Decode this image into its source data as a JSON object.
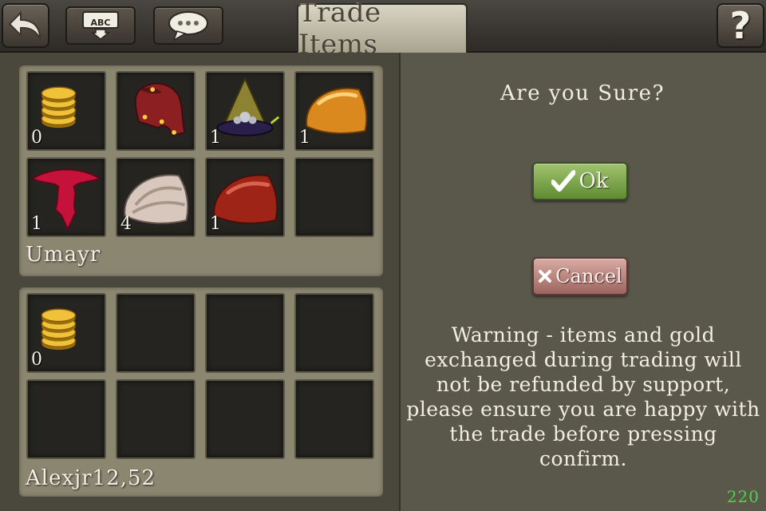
{
  "header": {
    "title": "Trade Items",
    "keyboard_label": "ABC",
    "help_label": "?"
  },
  "players": [
    {
      "name": "Umayr",
      "slots": [
        {
          "icon": "gold-coins-icon",
          "qty": "0"
        },
        {
          "icon": "red-jester-hat-icon",
          "qty": ""
        },
        {
          "icon": "skull-wizard-hat-icon",
          "qty": "1"
        },
        {
          "icon": "orange-cap-icon",
          "qty": "1"
        },
        {
          "icon": "red-wings-icon",
          "qty": "1"
        },
        {
          "icon": "marble-cap-icon",
          "qty": "4"
        },
        {
          "icon": "red-cap-icon",
          "qty": "1"
        },
        {
          "icon": "empty-slot",
          "qty": ""
        }
      ]
    },
    {
      "name": "Alexjr12,52",
      "slots": [
        {
          "icon": "gold-coins-icon",
          "qty": "0"
        },
        {
          "icon": "empty-slot",
          "qty": ""
        },
        {
          "icon": "empty-slot",
          "qty": ""
        },
        {
          "icon": "empty-slot",
          "qty": ""
        },
        {
          "icon": "empty-slot",
          "qty": ""
        },
        {
          "icon": "empty-slot",
          "qty": ""
        },
        {
          "icon": "empty-slot",
          "qty": ""
        },
        {
          "icon": "empty-slot",
          "qty": ""
        }
      ]
    }
  ],
  "dialog": {
    "question": "Are you Sure?",
    "ok_label": "Ok",
    "cancel_label": "Cancel",
    "warning": "Warning - items and gold exchanged during trading will not be refunded by support, please ensure you are happy with the trade before pressing confirm."
  },
  "counter": "220",
  "colors": {
    "ok": "#6f9a3e",
    "cancel": "#b87c76",
    "counter": "#4fd24f"
  }
}
